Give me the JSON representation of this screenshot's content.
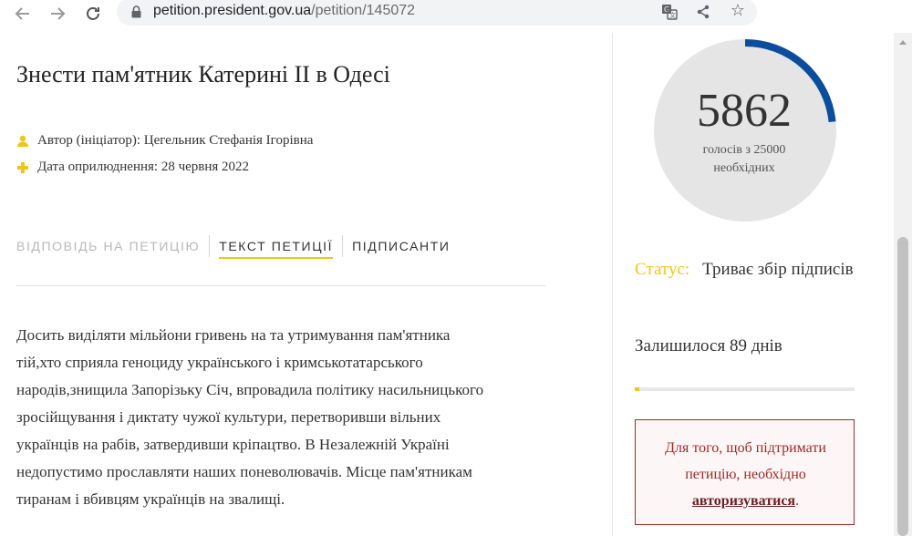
{
  "browser": {
    "url_domain": "petition.president.gov.ua",
    "url_path": "/petition/145072"
  },
  "petition": {
    "title": "Знести пам'ятник Катерині ІІ в Одесі",
    "author": "Автор (ініціатор): Цегельник Стефанія Ігорівна",
    "date": "Дата оприлюднення: 28 червня 2022",
    "tabs": [
      {
        "label": "ВІДПОВІДЬ НА ПЕТИЦІЮ"
      },
      {
        "label": "ТЕКСТ ПЕТИЦІЇ"
      },
      {
        "label": "ПІДПИСАНТИ"
      }
    ],
    "body_lines": [
      "Досить виділяти мільйони гривень на та утримування пам'ятника",
      "тій,хто сприяла геноциду українського і кримськотатарського",
      "народів,знищила Запорізьку Січ, впровадила політику насильницького",
      "зросійщування і диктату чужої культури, перетворивши вільних",
      "українців на рабів, затвердивши кріпацтво. В Незалежній Україні",
      "недопустимо прославляти наших поневолювачів. Місце пам'ятникам",
      "тиранам і вбивцям українців на звалищі."
    ]
  },
  "votes": {
    "count": "5862",
    "caption_line1": "голосів з 25000",
    "caption_line2": "необхідних",
    "progress_fraction": 0.2345
  },
  "status": {
    "label": "Статус:",
    "value": "Триває збір підписів"
  },
  "remaining": "Залишилося 89 днів",
  "days_progress_fraction": 0.02,
  "auth": {
    "text_before": "Для того, щоб підтримати петицію, необхідно",
    "link": "авторизуватися",
    "text_after": "."
  },
  "colors": {
    "accent_yellow": "#f0c51b",
    "gauge_blue": "#0a4d9c",
    "gauge_grey": "#e5e5e5",
    "alert_red": "#9b2a2a"
  }
}
